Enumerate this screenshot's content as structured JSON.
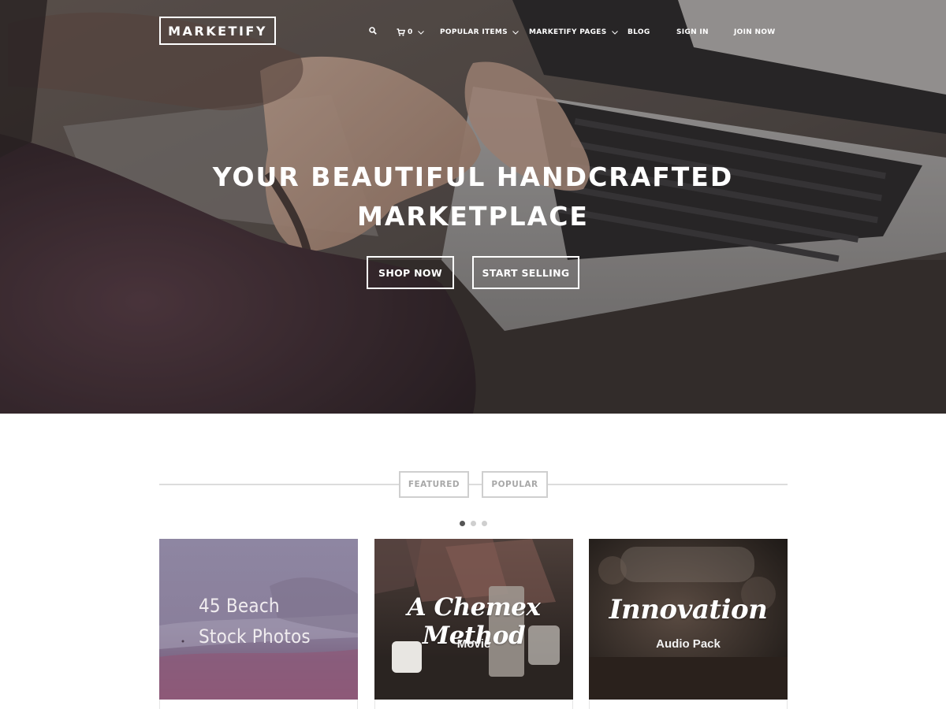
{
  "site": {
    "logo_text": "MARKETIFY"
  },
  "nav": {
    "search_icon": "search-icon",
    "cart_icon": "cart-icon",
    "cart_count": "0",
    "items": [
      {
        "label": "POPULAR ITEMS",
        "has_dropdown": true
      },
      {
        "label": "MARKETIFY PAGES",
        "has_dropdown": true
      },
      {
        "label": "BLOG",
        "has_dropdown": false
      },
      {
        "label": "SIGN IN",
        "has_dropdown": false
      },
      {
        "label": "JOIN NOW",
        "has_dropdown": false
      }
    ]
  },
  "hero": {
    "title_line1": "YOUR BEAUTIFUL HANDCRAFTED",
    "title_line2": "MARKETPLACE",
    "primary_button": "SHOP NOW",
    "secondary_button": "START SELLING"
  },
  "product_tabs": {
    "tabs": [
      "FEATURED",
      "POPULAR"
    ],
    "active_slide": 1,
    "slide_count": 3
  },
  "products": [
    {
      "title_line1": "45 Beach",
      "title_line2": "Stock Photos"
    },
    {
      "title": "A Chemex Method",
      "subtitle": "Movie"
    },
    {
      "title": "Innovation",
      "subtitle": "Audio Pack"
    }
  ],
  "colors": {
    "hero_overlay": "#1c1818",
    "text_on_hero": "#ffffff",
    "tab_border": "#cfcfcf",
    "tab_text": "#a8a8a8",
    "dot_active": "#555555",
    "dot_inactive": "#cfcfcf"
  }
}
